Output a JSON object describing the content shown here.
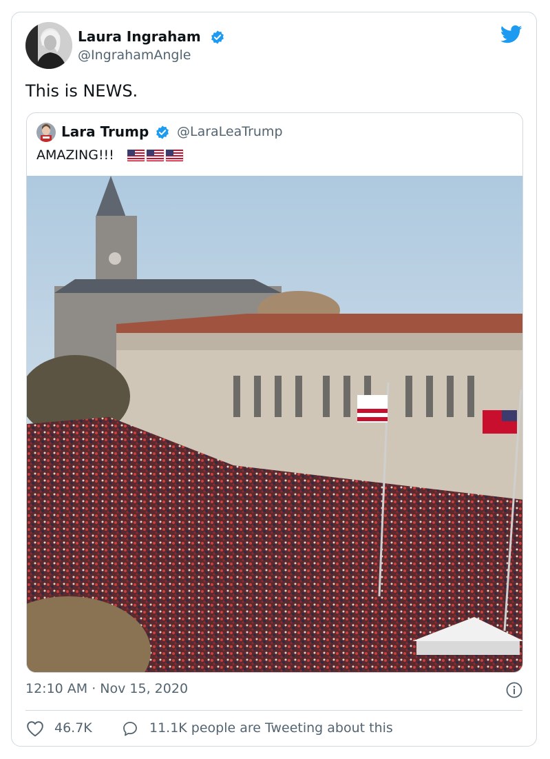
{
  "author": {
    "name": "Laura Ingraham",
    "handle": "@IngrahamAngle",
    "avatar_icon": "profile-photo"
  },
  "tweet": {
    "text": "This is NEWS.",
    "timestamp": "12:10 AM · Nov 15, 2020"
  },
  "quoted": {
    "name": "Lara Trump",
    "handle": "@LaraLeaTrump",
    "text": "AMAZING!!!",
    "flag_count": 3,
    "media_icon": "crowd-rally-photo"
  },
  "engagement": {
    "likes": "46.7K",
    "conversation": "11.1K people are Tweeting about this"
  },
  "colors": {
    "twitter_blue": "#1d9bf0",
    "text_primary": "#0f1419",
    "text_secondary": "#536471",
    "border": "#cfd9de"
  }
}
